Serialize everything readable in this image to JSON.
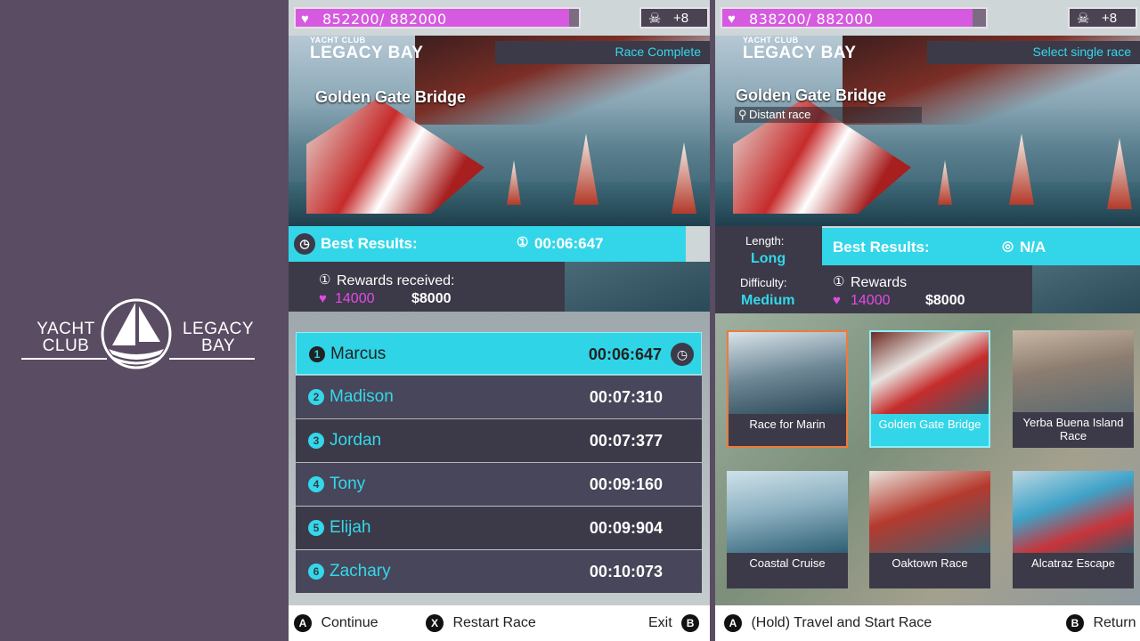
{
  "brand": {
    "left_line1": "YACHT",
    "left_line2": "CLUB",
    "right_line1": "LEGACY",
    "right_line2": "BAY"
  },
  "results_panel": {
    "hp_text": "852200/ 882000",
    "hp_fraction": 0.966,
    "skull_count": "+8",
    "logo_small": "YACHT CLUB",
    "logo_big": "LEGACY BAY",
    "status": "Race Complete",
    "track": "Golden Gate Bridge",
    "best_label": "Best Results:",
    "best_time": "00:06:647",
    "rewards_label": "Rewards received:",
    "reward_hearts": "14000",
    "reward_cash": "$8000",
    "leaderboard": [
      {
        "rank": "1",
        "name": "Marcus",
        "time": "00:06:647"
      },
      {
        "rank": "2",
        "name": "Madison",
        "time": "00:07:310"
      },
      {
        "rank": "3",
        "name": "Jordan",
        "time": "00:07:377"
      },
      {
        "rank": "4",
        "name": "Tony",
        "time": "00:09:160"
      },
      {
        "rank": "5",
        "name": "Elijah",
        "time": "00:09:904"
      },
      {
        "rank": "6",
        "name": "Zachary",
        "time": "00:10:073"
      }
    ],
    "footer": {
      "a_key": "A",
      "a_label": "Continue",
      "x_key": "X",
      "x_label": "Restart Race",
      "b_key": "B",
      "b_label": "Exit"
    }
  },
  "select_panel": {
    "hp_text": "838200/ 882000",
    "hp_fraction": 0.95,
    "skull_count": "+8",
    "logo_small": "YACHT CLUB",
    "logo_big": "LEGACY BAY",
    "status": "Select single race",
    "track": "Golden Gate Bridge",
    "location": "Distant race",
    "length_label": "Length:",
    "length_value": "Long",
    "difficulty_label": "Difficulty:",
    "difficulty_value": "Medium",
    "best_label": "Best Results:",
    "best_value": "N/A",
    "rewards_label": "Rewards",
    "reward_hearts": "14000",
    "reward_cash": "$8000",
    "races": [
      "Race for Marin",
      "Golden Gate Bridge",
      "Yerba Buena Island Race",
      "Coastal Cruise",
      "Oaktown Race",
      "Alcatraz Escape"
    ],
    "footer": {
      "a_key": "A",
      "a_label": "(Hold) Travel and Start Race",
      "b_key": "B",
      "b_label": "Return"
    }
  },
  "colors": {
    "accent_cyan": "#33d6e8",
    "heart_pink": "#e24be6",
    "panel_dark": "#3c3a48",
    "brand_bg": "#5a4c62"
  }
}
